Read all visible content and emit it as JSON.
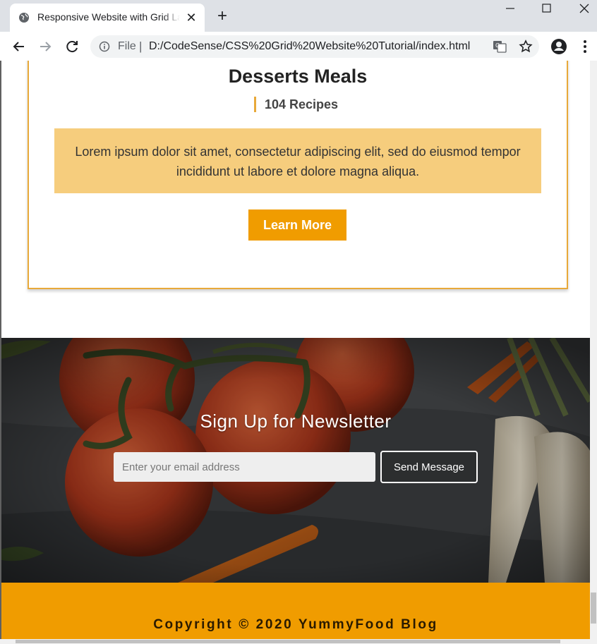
{
  "browser": {
    "tab_title": "Responsive Website with Grid Layout",
    "url_scheme": "File",
    "url_separator": "|",
    "url": "D:/CodeSense/CSS%20Grid%20Website%20Tutorial/index.html",
    "new_tab_glyph": "+",
    "tab_close_glyph": "✕"
  },
  "card": {
    "title": "Desserts Meals",
    "count": "104 Recipes",
    "description": "Lorem ipsum dolor sit amet, consectetur adipiscing elit, sed do eiusmod tempor incididunt ut labore et dolore magna aliqua.",
    "button_label": "Learn More"
  },
  "newsletter": {
    "title": "Sign Up for Newsletter",
    "email_placeholder": "Enter your email address",
    "button_label": "Send Message"
  },
  "footer": {
    "text": "Copyright © 2020 YummyFood Blog"
  },
  "colors": {
    "accent": "#f09c00",
    "card_border": "#e8a93a",
    "card_desc_bg": "#f6cd7d"
  },
  "icons": [
    "globe-icon",
    "close-icon",
    "plus-icon",
    "minimize-icon",
    "maximize-icon",
    "window-close-icon",
    "back-arrow-icon",
    "forward-arrow-icon",
    "reload-icon",
    "info-icon",
    "translate-icon",
    "star-icon",
    "profile-icon",
    "kebab-menu-icon",
    "mouse-cursor-icon"
  ]
}
